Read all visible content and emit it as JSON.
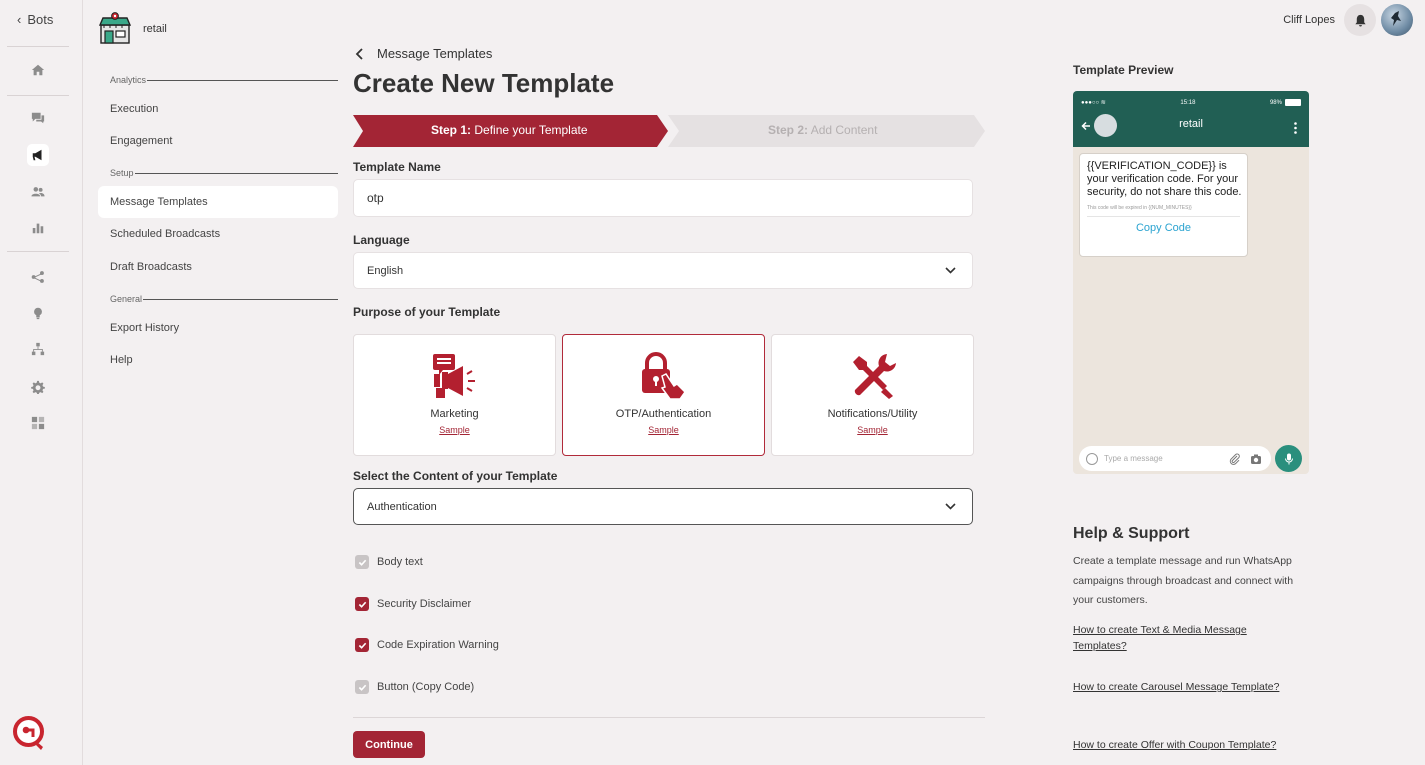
{
  "rail": {
    "back_label": "Bots",
    "icons": [
      "home-icon",
      "chat-icon",
      "megaphone-icon",
      "users-icon",
      "analytics-icon",
      "flow-icon",
      "bulb-icon",
      "hierarchy-icon",
      "gear-icon",
      "integrations-icon"
    ],
    "active_icon": "megaphone-icon"
  },
  "bot": {
    "name": "retail"
  },
  "nav": {
    "group_analytics": "Analytics",
    "group_setup": "Setup",
    "group_general": "General",
    "items": [
      "Execution",
      "Engagement",
      "Message Templates",
      "Scheduled Broadcasts",
      "Draft Broadcasts",
      "Export History",
      "Help"
    ],
    "selected": "Message Templates"
  },
  "header": {
    "breadcrumb": "Message Templates",
    "title": "Create New Template"
  },
  "steps": {
    "step1_prefix": "Step 1:",
    "step1_label": "Define your Template",
    "step2_prefix": "Step 2:",
    "step2_label": "Add Content"
  },
  "form": {
    "name_label": "Template Name",
    "name_value": "otp",
    "language_label": "Language",
    "language_value": "English",
    "purpose_label": "Purpose of your Template",
    "purposes": [
      {
        "name": "Marketing",
        "sample": "Sample",
        "icon": "megaphone-icon"
      },
      {
        "name": "OTP/Authentication",
        "sample": "Sample",
        "icon": "lock-icon"
      },
      {
        "name": "Notifications/Utility",
        "sample": "Sample",
        "icon": "tools-icon"
      }
    ],
    "selected_purpose": "OTP/Authentication",
    "content_label": "Select the Content of your Template",
    "content_value": "Authentication",
    "checks": [
      {
        "label": "Body text",
        "checked": true,
        "disabled": true
      },
      {
        "label": "Security Disclaimer",
        "checked": true,
        "disabled": false
      },
      {
        "label": "Code Expiration Warning",
        "checked": true,
        "disabled": false
      },
      {
        "label": "Button (Copy Code)",
        "checked": true,
        "disabled": true
      }
    ],
    "continue_label": "Continue"
  },
  "user": {
    "name": "Cliff Lopes"
  },
  "preview": {
    "title": "Template Preview",
    "status_time": "15:18",
    "status_battery": "98%",
    "contact": "retail",
    "message": "{{VERIFICATION_CODE}} is your verification code. For your security, do not share this code.",
    "footer": "This code will be expired in {{NUM_MINUTES}}",
    "button": "Copy Code",
    "type_placeholder": "Type a message"
  },
  "help": {
    "title": "Help & Support",
    "description": "Create a template message and run WhatsApp campaigns through broadcast and connect with your customers.",
    "links": [
      "How to create Text & Media Message Templates?",
      "How to create Carousel Message Template?",
      "How to create Offer with Coupon Template?"
    ]
  },
  "colors": {
    "brand": "#a32535",
    "wa_header": "#215f54",
    "wa_bg": "#ece5dd",
    "link": "#2aa3d0"
  }
}
